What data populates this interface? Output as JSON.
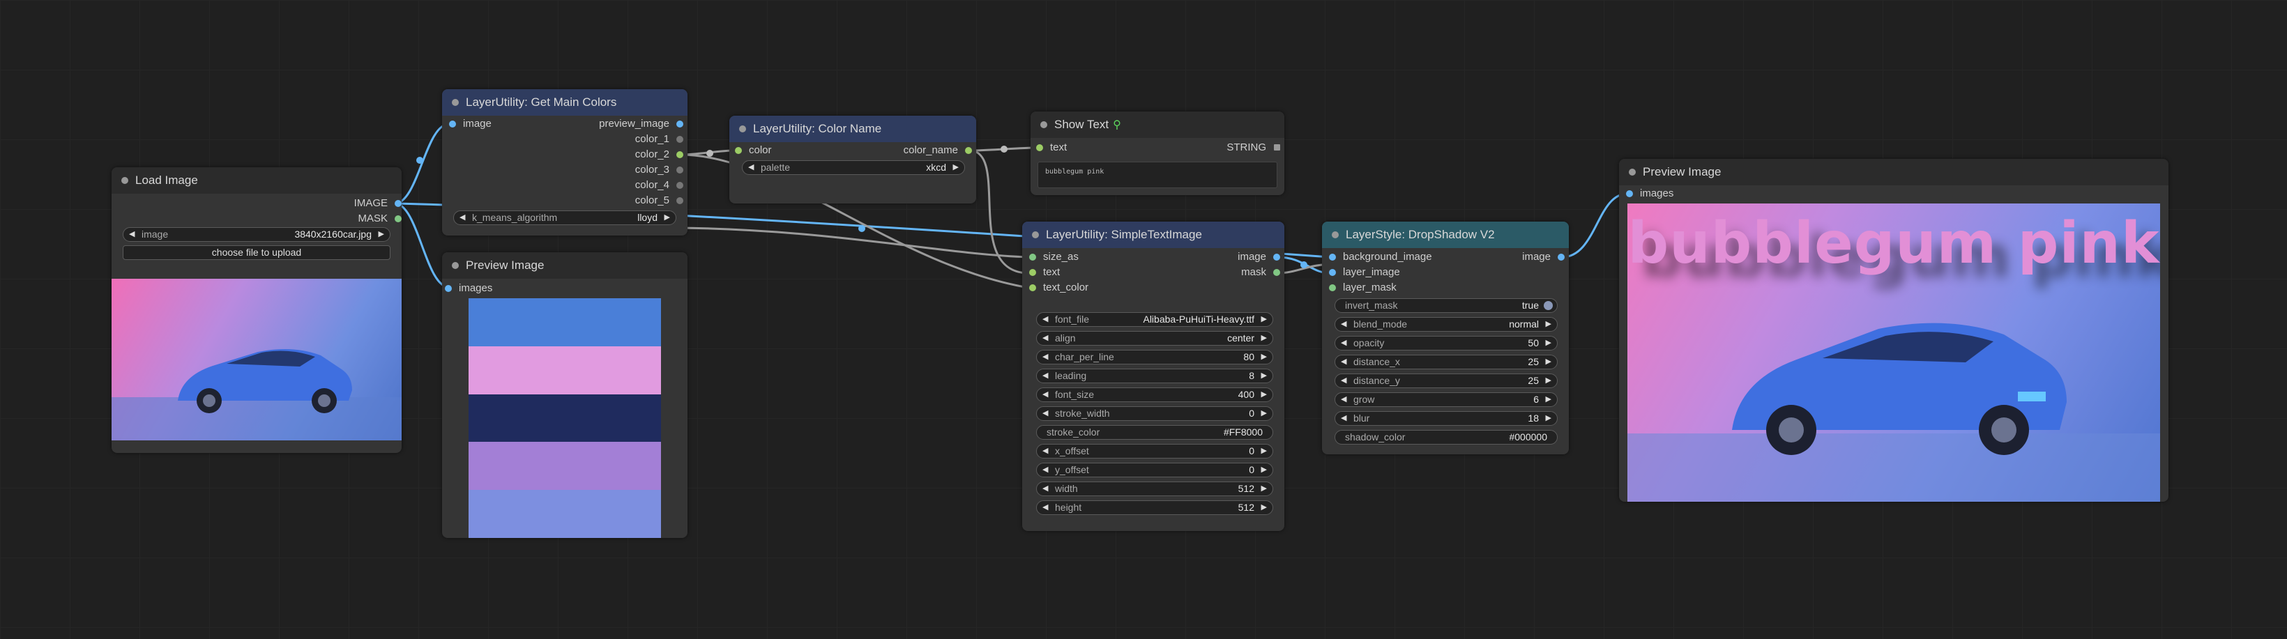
{
  "nodes": {
    "load_image": {
      "title": "Load Image",
      "outputs": [
        "IMAGE",
        "MASK"
      ],
      "image_label": "image",
      "image_value": "3840x2160car.jpg",
      "upload_button": "choose file to upload"
    },
    "get_main_colors": {
      "title": "LayerUtility: Get Main Colors",
      "input": "image",
      "outputs": [
        "preview_image",
        "color_1",
        "color_2",
        "color_3",
        "color_4",
        "color_5"
      ],
      "widget_label": "k_means_algorithm",
      "widget_value": "lloyd"
    },
    "preview_colors": {
      "title": "Preview Image",
      "input": "images",
      "swatches": [
        "#4a7fd8",
        "#e19be0",
        "#1f2b5e",
        "#a37fd6",
        "#7d8fe0"
      ]
    },
    "color_name": {
      "title": "LayerUtility: Color Name",
      "input": "color",
      "output": "color_name",
      "widget_label": "palette",
      "widget_value": "xkcd"
    },
    "show_text": {
      "title": "Show Text",
      "input": "text",
      "output": "STRING",
      "content": "bubblegum pink"
    },
    "simple_text": {
      "title": "LayerUtility: SimpleTextImage",
      "inputs": [
        "size_as",
        "text",
        "text_color"
      ],
      "outputs": [
        "image",
        "mask"
      ],
      "widgets": [
        {
          "label": "font_file",
          "value": "Alibaba-PuHuiTi-Heavy.ttf",
          "kind": "combo"
        },
        {
          "label": "align",
          "value": "center",
          "kind": "combo"
        },
        {
          "label": "char_per_line",
          "value": "80",
          "kind": "combo"
        },
        {
          "label": "leading",
          "value": "8",
          "kind": "combo"
        },
        {
          "label": "font_size",
          "value": "400",
          "kind": "combo"
        },
        {
          "label": "stroke_width",
          "value": "0",
          "kind": "combo"
        },
        {
          "label": "stroke_color",
          "value": "#FF8000",
          "kind": "text"
        },
        {
          "label": "x_offset",
          "value": "0",
          "kind": "combo"
        },
        {
          "label": "y_offset",
          "value": "0",
          "kind": "combo"
        },
        {
          "label": "width",
          "value": "512",
          "kind": "combo"
        },
        {
          "label": "height",
          "value": "512",
          "kind": "combo"
        }
      ]
    },
    "drop_shadow": {
      "title": "LayerStyle: DropShadow V2",
      "inputs": [
        "background_image",
        "layer_image",
        "layer_mask"
      ],
      "output": "image",
      "widgets": [
        {
          "label": "invert_mask",
          "value": "true",
          "kind": "toggle"
        },
        {
          "label": "blend_mode",
          "value": "normal",
          "kind": "combo"
        },
        {
          "label": "opacity",
          "value": "50",
          "kind": "combo"
        },
        {
          "label": "distance_x",
          "value": "25",
          "kind": "combo"
        },
        {
          "label": "distance_y",
          "value": "25",
          "kind": "combo"
        },
        {
          "label": "grow",
          "value": "6",
          "kind": "combo"
        },
        {
          "label": "blur",
          "value": "18",
          "kind": "combo"
        },
        {
          "label": "shadow_color",
          "value": "#000000",
          "kind": "text"
        }
      ]
    },
    "preview_result": {
      "title": "Preview Image",
      "input": "images",
      "overlay_text": "bubblegum pink"
    }
  },
  "colors": {
    "canvas": "#202020",
    "node_body": "#353535",
    "wire_image": "#64b5f6",
    "wire_other": "#9a9a9a",
    "text_pink": "#e28fd6"
  }
}
